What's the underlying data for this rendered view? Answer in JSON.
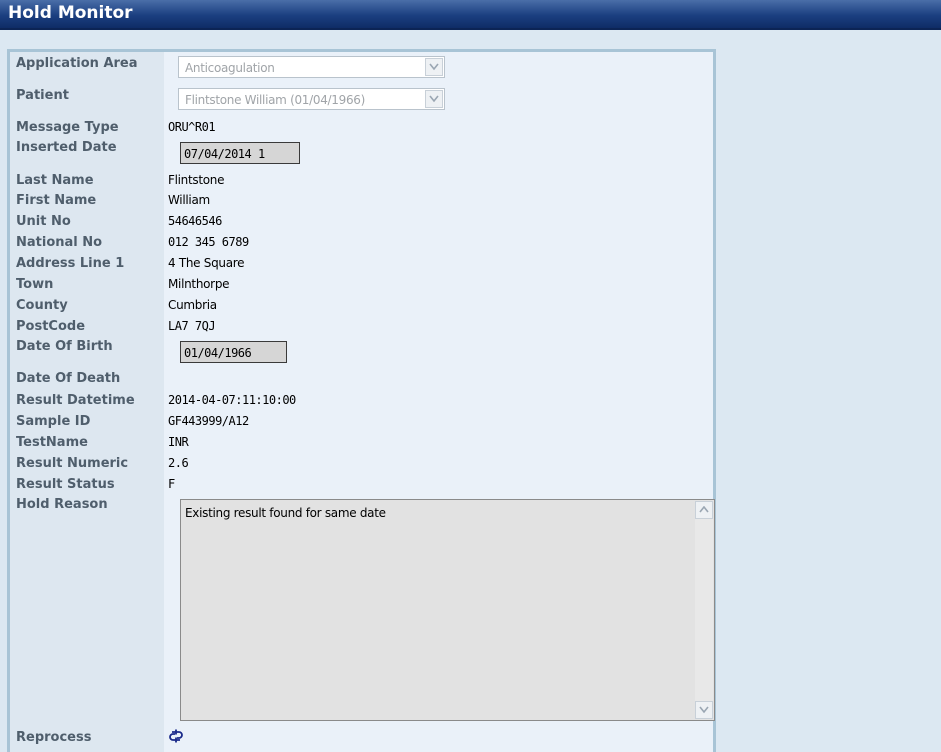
{
  "header": {
    "title": "Hold Monitor"
  },
  "fields": {
    "application_area": {
      "label": "Application Area",
      "value": "Anticoagulation"
    },
    "patient": {
      "label": "Patient",
      "value": "Flintstone William (01/04/1966)"
    },
    "message_type": {
      "label": "Message Type",
      "value": "ORU^R01"
    },
    "inserted_date": {
      "label": "Inserted Date",
      "value": "07/04/2014 1"
    },
    "last_name": {
      "label": "Last Name",
      "value": "Flintstone"
    },
    "first_name": {
      "label": "First Name",
      "value": "William"
    },
    "unit_no": {
      "label": "Unit No",
      "value": "54646546"
    },
    "national_no": {
      "label": "National No",
      "value": "012 345 6789"
    },
    "address_line_1": {
      "label": "Address Line 1",
      "value": "4 The Square"
    },
    "town": {
      "label": "Town",
      "value": "Milnthorpe"
    },
    "county": {
      "label": "County",
      "value": "Cumbria"
    },
    "postcode": {
      "label": "PostCode",
      "value": "LA7 7QJ"
    },
    "date_of_birth": {
      "label": "Date Of Birth",
      "value": "01/04/1966"
    },
    "date_of_death": {
      "label": "Date Of Death",
      "value": ""
    },
    "result_datetime": {
      "label": "Result Datetime",
      "value": "2014-04-07:11:10:00"
    },
    "sample_id": {
      "label": "Sample ID",
      "value": "GF443999/A12"
    },
    "testname": {
      "label": "TestName",
      "value": "INR"
    },
    "result_numeric": {
      "label": "Result Numeric",
      "value": "2.6"
    },
    "result_status": {
      "label": "Result Status",
      "value": "F"
    },
    "hold_reason": {
      "label": "Hold Reason",
      "value": "Existing result found for same date"
    },
    "reprocess": {
      "label": "Reprocess",
      "icon": "reprocess-icon"
    }
  },
  "colors": {
    "header_bg": "#1b3f80",
    "label_text": "#4f5e6c",
    "panel_bg": "#eaf1f9",
    "page_bg": "#dce8f2"
  }
}
